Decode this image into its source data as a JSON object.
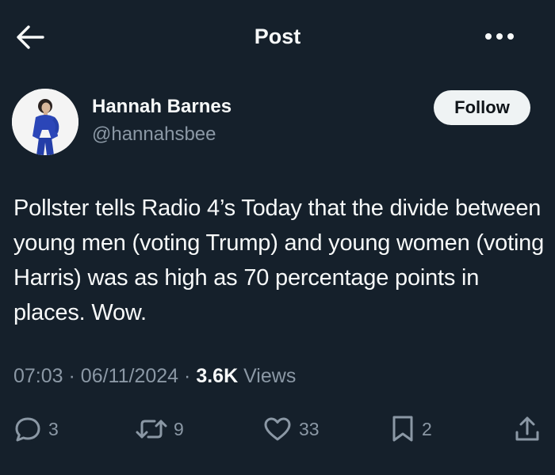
{
  "header": {
    "title": "Post",
    "back_icon": "arrow-left-icon",
    "more_icon": "more-horizontal-icon"
  },
  "author": {
    "name": "Hannah Barnes",
    "handle": "@hannahsbee",
    "follow_label": "Follow"
  },
  "post": {
    "text": "Pollster tells Radio 4’s Today that the divide between young men (voting Trump) and young women (voting Harris) was as high as 70 percentage points in places. Wow.",
    "time": "07:03",
    "date": "06/11/2024",
    "views_count": "3.6K",
    "views_label": "Views",
    "separator": "·"
  },
  "actions": {
    "replies": "3",
    "reposts": "9",
    "likes": "33",
    "bookmarks": "2"
  },
  "colors": {
    "background": "#15202b",
    "text": "#f7f9f9",
    "muted": "#8b98a5",
    "follow_bg": "#eff3f4"
  }
}
